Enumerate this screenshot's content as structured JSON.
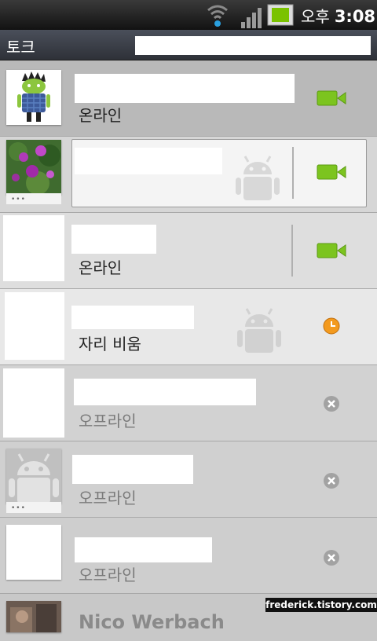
{
  "status_bar": {
    "ampm": "오후",
    "time": "3:08",
    "battery_color": "#7ac200"
  },
  "header": {
    "title": "토크",
    "search_value": ""
  },
  "contacts": [
    {
      "status": "온라인",
      "status_icon": "video-chat-icon",
      "avatar": "android-avatar-icon",
      "selected": true
    },
    {
      "status": "",
      "status_icon": "video-chat-icon",
      "avatar": "flower-photo"
    },
    {
      "status": "온라인",
      "status_icon": "video-chat-icon",
      "avatar": "blank"
    },
    {
      "status": "자리 비움",
      "status_icon": "away-clock-icon",
      "avatar": "blank"
    },
    {
      "status": "오프라인",
      "status_icon": "offline-x-icon",
      "avatar": "blank"
    },
    {
      "status": "오프라인",
      "status_icon": "offline-x-icon",
      "avatar": "default-android-avatar"
    },
    {
      "status": "오프라인",
      "status_icon": "offline-x-icon",
      "avatar": "blank"
    },
    {
      "name": "Nico Werbach",
      "avatar": "photo"
    }
  ],
  "colors": {
    "video": "#7cc41f",
    "away": "#f39a1e",
    "offline": "#9a9a9a"
  },
  "watermark": "frederick.tistory.com"
}
